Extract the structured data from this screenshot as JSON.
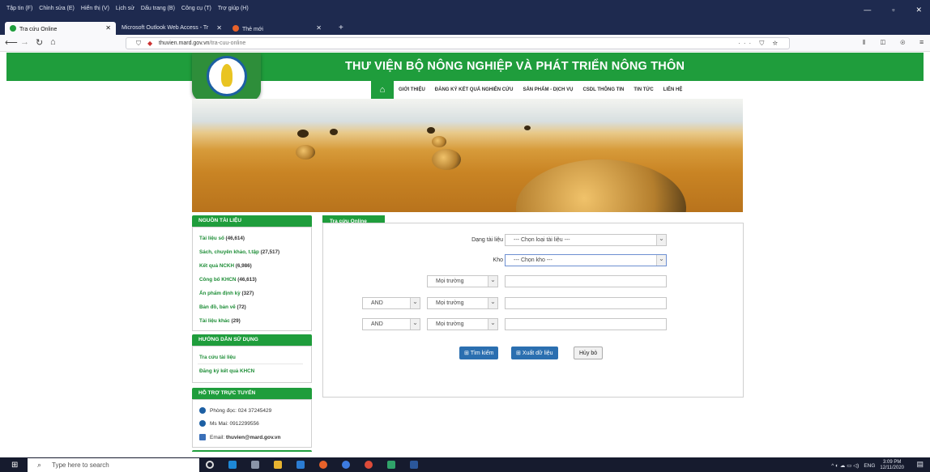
{
  "browser": {
    "menu": [
      "Tập tin (F)",
      "Chỉnh sửa (E)",
      "Hiển thị (V)",
      "Lịch sử",
      "Dấu trang (B)",
      "Công cụ (T)",
      "Trợ giúp (H)"
    ],
    "tabs": [
      {
        "label": "Tra cứu Online",
        "active": true
      },
      {
        "label": "Microsoft Outlook Web Access - Tr",
        "active": false
      },
      {
        "label": "Thẻ mới",
        "active": false
      }
    ],
    "url_domain": "thuvien.mard.gov.vn",
    "url_path": "/tra-cuu-online",
    "colors": {
      "titlebar": "#1e2a4f",
      "toolbar": "#f9f9fb"
    }
  },
  "site": {
    "title": "THƯ VIỆN BỘ NÔNG NGHIỆP VÀ PHÁT TRIỂN NÔNG THÔN",
    "nav": [
      "GIỚI THIỆU",
      "ĐĂNG KÝ KẾT QUẢ NGHIÊN CỨU",
      "SẢN PHẨM - DỊCH VỤ",
      "CSDL THÔNG TIN",
      "TIN TỨC",
      "LIÊN HỆ"
    ],
    "brand_color": "#1f9d3c"
  },
  "sidebar": {
    "sources_title": "NGUỒN TÀI LIỆU",
    "sources": [
      {
        "label": "Tài liệu số",
        "count": "(46,614)"
      },
      {
        "label": "Sách, chuyên khảo, t.tập",
        "count": "(27,517)"
      },
      {
        "label": "Kết quả NCKH",
        "count": "(6,986)"
      },
      {
        "label": "Công bố KHCN",
        "count": "(46,613)"
      },
      {
        "label": "Ấn phẩm định kỳ",
        "count": "(327)"
      },
      {
        "label": "Bản đồ, bản vẽ",
        "count": "(72)"
      },
      {
        "label": "Tài liệu khác",
        "count": "(29)"
      }
    ],
    "guide_title": "HƯỚNG DẪN SỬ DỤNG",
    "guide_links": [
      "Tra cứu tài liệu",
      "Đăng ký kết quả KHCN"
    ],
    "support_title": "HỖ TRỢ TRỰC TUYẾN",
    "support": [
      {
        "icon": "skype-icon",
        "text": "Phòng đọc: 024 37245429"
      },
      {
        "icon": "skype-icon",
        "text": "Ms Mai: 0912299556"
      },
      {
        "icon": "mail-icon",
        "text": "Email: ",
        "bold": "thuvien@mard.gov.vn"
      }
    ]
  },
  "search": {
    "tab_label": "Tra cứu Online",
    "doc_type_label": "Dạng tài liệu",
    "doc_type_value": "--- Chọn loại tài liệu ---",
    "repo_label": "Kho",
    "repo_value": "--- Chọn kho ---",
    "field_value": "Mọi trường",
    "operator_value": "AND",
    "search_button": "Tìm kiếm",
    "export_button": "Xuất dữ liệu",
    "cancel_button": "Hủy bỏ"
  },
  "taskbar": {
    "search_placeholder": "Type here to search",
    "lang": "ENG",
    "time": "3:09 PM",
    "date": "12/11/2020"
  }
}
